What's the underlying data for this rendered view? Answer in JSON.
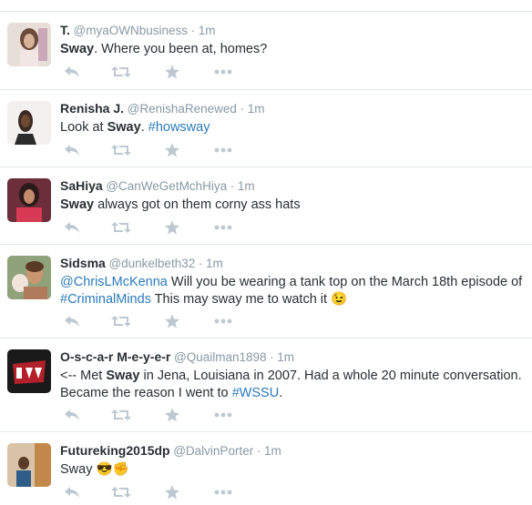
{
  "colors": {
    "link": "#2b7bb9",
    "meta": "#8899a6",
    "icon": "#bdc8d1",
    "divider": "#e1e8ed"
  },
  "action_icons": [
    "reply-icon",
    "retweet-icon",
    "favorite-icon",
    "more-icon"
  ],
  "tweets": [
    {
      "name": "T.",
      "handle": "@myaOWNbusiness",
      "dot": "·",
      "time": "1m",
      "parts": [
        {
          "t": "Sway",
          "bold": true
        },
        {
          "t": ". Where you been at, homes?"
        }
      ]
    },
    {
      "name": "Renisha J.",
      "handle": "@RenishaRenewed",
      "dot": "·",
      "time": "1m",
      "parts": [
        {
          "t": "Look at "
        },
        {
          "t": "Sway",
          "bold": true
        },
        {
          "t": ". "
        },
        {
          "t": "#howsway",
          "link": true
        }
      ]
    },
    {
      "name": "SaHiya",
      "handle": "@CanWeGetMchHiya",
      "dot": "·",
      "time": "1m",
      "parts": [
        {
          "t": "Sway",
          "bold": true
        },
        {
          "t": " always got on them corny ass hats"
        }
      ]
    },
    {
      "name": "Sidsma",
      "handle": "@dunkelbeth32",
      "dot": "·",
      "time": "1m",
      "parts": [
        {
          "t": "@ChrisLMcKenna",
          "link": true
        },
        {
          "t": " Will you be wearing a tank top on the March 18th episode of "
        },
        {
          "t": "#CriminalMinds",
          "link": true
        },
        {
          "t": " This may sway me to watch it "
        },
        {
          "t": "😉"
        }
      ]
    },
    {
      "name": "O-s-c-a-r M-e-y-e-r",
      "handle": "@Quailman1898",
      "dot": "·",
      "time": "1m",
      "parts": [
        {
          "t": "<-- Met "
        },
        {
          "t": "Sway",
          "bold": true
        },
        {
          "t": " in Jena, Louisiana in 2007. Had a whole 20 minute conversation. Became the reason I went to "
        },
        {
          "t": "#WSSU",
          "link": true
        },
        {
          "t": "."
        }
      ]
    },
    {
      "name": "Futureking2015dp",
      "handle": "@DalvinPorter",
      "dot": "·",
      "time": "1m",
      "parts": [
        {
          "t": "Sway "
        },
        {
          "t": "😎✊"
        }
      ]
    }
  ]
}
